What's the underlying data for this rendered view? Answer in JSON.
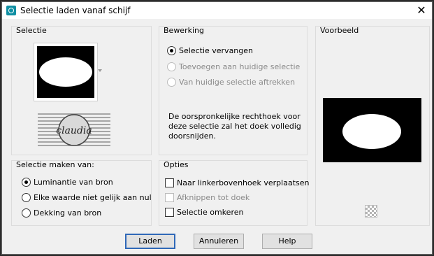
{
  "window": {
    "title": "Selectie laden vanaf schijf",
    "close": "✕"
  },
  "selectie": {
    "label": "Selectie",
    "watermark_text": "claudia"
  },
  "bewerking": {
    "label": "Bewerking",
    "options": [
      {
        "label": "Selectie vervangen",
        "selected": true,
        "enabled": true
      },
      {
        "label": "Toevoegen aan huidige selectie",
        "selected": false,
        "enabled": false
      },
      {
        "label": "Van huidige selectie aftrekken",
        "selected": false,
        "enabled": false
      }
    ],
    "description": "De oorspronkelijke rechthoek voor deze selectie zal het doek volledig doorsnijden."
  },
  "voorbeeld": {
    "label": "Voorbeeld"
  },
  "maken_van": {
    "label": "Selectie maken van:",
    "options": [
      {
        "label": "Luminantie van bron",
        "selected": true
      },
      {
        "label": "Elke waarde niet gelijk aan nul",
        "selected": false
      },
      {
        "label": "Dekking van bron",
        "selected": false
      }
    ]
  },
  "opties": {
    "label": "Opties",
    "options": [
      {
        "label": "Naar linkerbovenhoek verplaatsen",
        "checked": false,
        "enabled": true
      },
      {
        "label": "Afknippen tot doek",
        "checked": false,
        "enabled": false
      },
      {
        "label": "Selectie omkeren",
        "checked": false,
        "enabled": true
      }
    ]
  },
  "buttons": {
    "load": "Laden",
    "cancel": "Annuleren",
    "help": "Help"
  },
  "colors": {
    "accent": "#2f68b8",
    "icon": "#0f8fa3"
  }
}
